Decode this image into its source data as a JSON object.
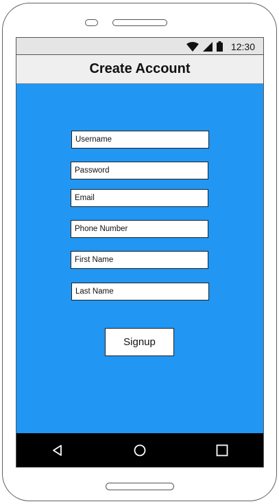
{
  "status_bar": {
    "time": "12:30",
    "icons": [
      "wifi-icon",
      "signal-icon",
      "battery-icon"
    ]
  },
  "app_bar": {
    "title": "Create Account"
  },
  "form": {
    "username": {
      "placeholder": "Username",
      "value": ""
    },
    "password": {
      "placeholder": "Password",
      "value": ""
    },
    "email": {
      "placeholder": "Email",
      "value": ""
    },
    "phone": {
      "placeholder": "Phone Number",
      "value": ""
    },
    "first_name": {
      "placeholder": "First Name",
      "value": ""
    },
    "last_name": {
      "placeholder": "Last Name",
      "value": ""
    },
    "signup_label": "Signup"
  },
  "nav_bar": {
    "buttons": [
      "back-icon",
      "home-icon",
      "recents-icon"
    ]
  },
  "colors": {
    "screen_background": "#2196f3",
    "status_bar": "#e5e5e5",
    "app_bar": "#efefef",
    "nav_bar": "#000000"
  }
}
